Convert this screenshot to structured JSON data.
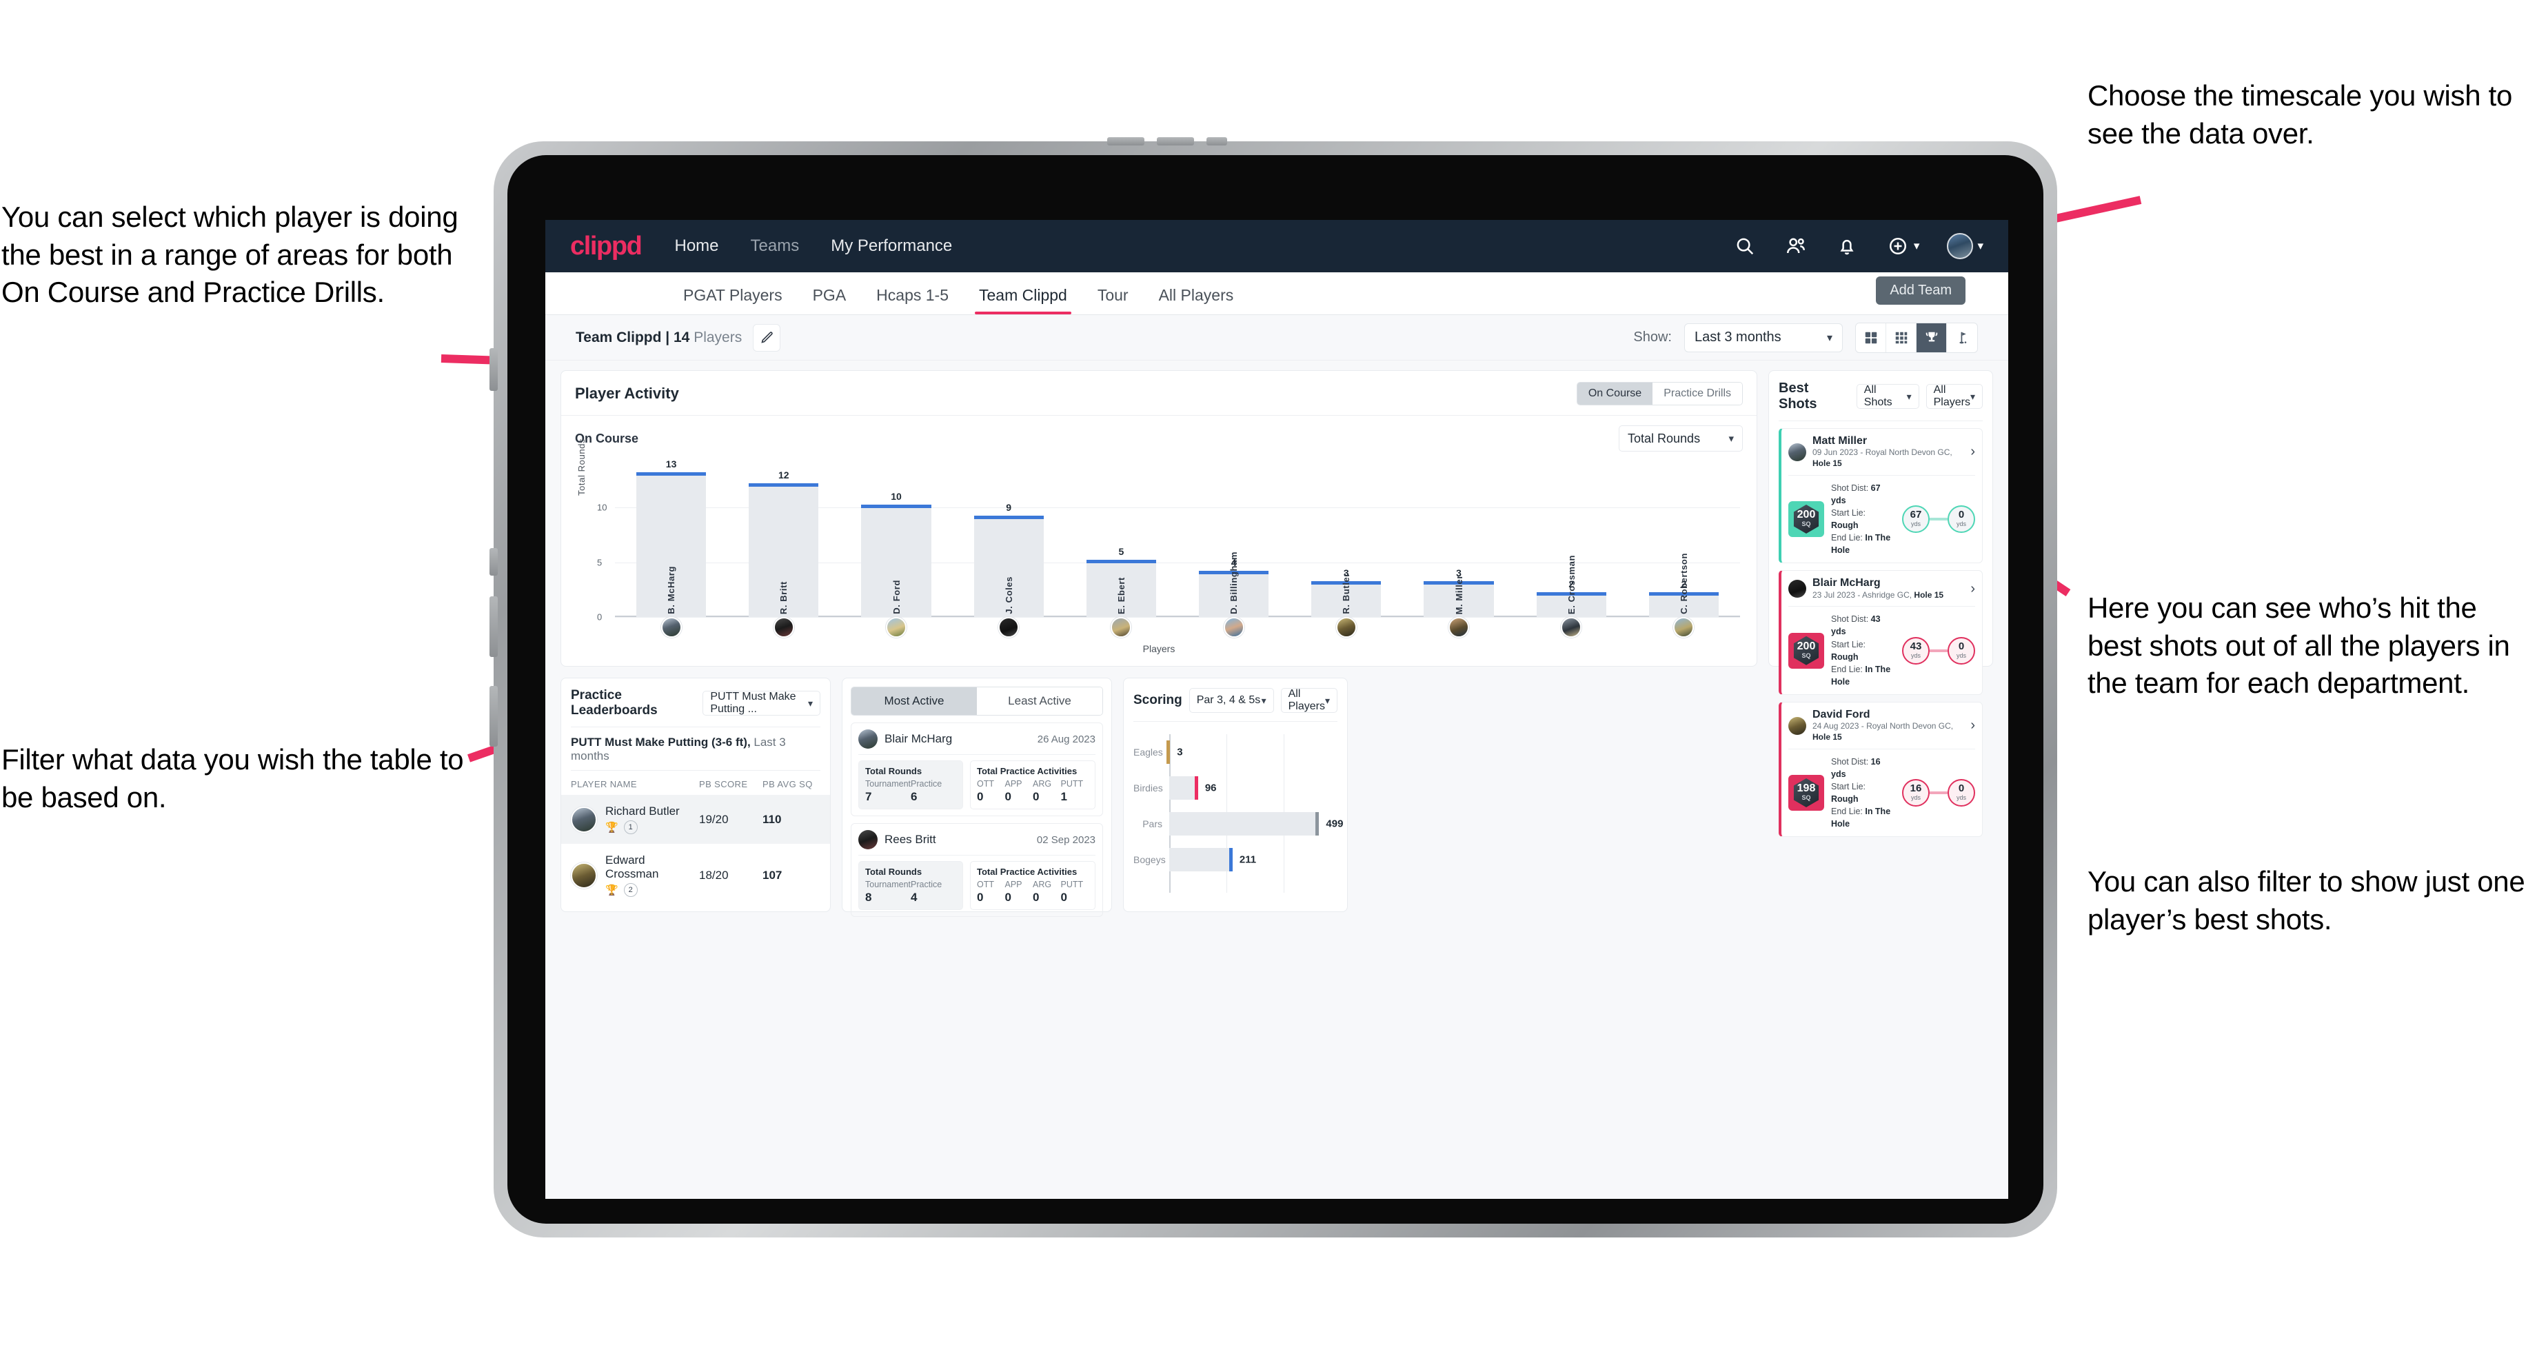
{
  "annotations": {
    "left_top": "You can select which player is doing the best in a range of areas for both On Course and Practice Drills.",
    "left_bottom": "Filter what data you wish the table to be based on.",
    "right_top": "Choose the timescale you wish to see the data over.",
    "right_mid": "Here you can see who’s hit the best shots out of all the players in the team for each department.",
    "right_bottom": "You can also filter to show just one player’s best shots."
  },
  "topnav": {
    "logo": "clippd",
    "links": [
      {
        "label": "Home"
      },
      {
        "label": "Teams"
      },
      {
        "label": "My Performance"
      }
    ],
    "icons": [
      "search-icon",
      "people-icon",
      "bell-icon",
      "plus-circle-icon",
      "avatar"
    ]
  },
  "tabs": [
    {
      "label": "PGAT Players",
      "active": false
    },
    {
      "label": "PGA",
      "active": false
    },
    {
      "label": "Hcaps 1-5",
      "active": false
    },
    {
      "label": "Team Clippd",
      "active": true
    },
    {
      "label": "Tour",
      "active": false
    },
    {
      "label": "All Players",
      "active": false
    }
  ],
  "tooltip": {
    "add_team": "Add Team"
  },
  "subheader": {
    "team_name": "Team Clippd",
    "separator": " | ",
    "player_count": "14",
    "players_word": " Players",
    "show_label": "Show:",
    "timescale_value": "Last 3 months",
    "view_icons": [
      "grid-2x2-icon",
      "grid-3x3-icon",
      "trophy-icon",
      "flag-icon"
    ],
    "active_view": "trophy-icon"
  },
  "player_activity": {
    "title": "Player Activity",
    "segments": [
      {
        "label": "On Course",
        "active": true
      },
      {
        "label": "Practice Drills",
        "active": false
      }
    ],
    "sub_label": "On Course",
    "metric_select": "Total Rounds"
  },
  "chart_data": {
    "type": "bar",
    "title": "Player Activity - On Course",
    "xlabel": "Players",
    "ylabel": "Total Rounds",
    "ylim": [
      0,
      14
    ],
    "yticks": [
      0,
      5,
      10
    ],
    "grid": true,
    "categories": [
      "B. McHarg",
      "R. Britt",
      "D. Ford",
      "J. Coles",
      "E. Ebert",
      "D. Billingham",
      "R. Butler",
      "M. Miller",
      "E. Crossman",
      "C. Robertson"
    ],
    "values": [
      13,
      12,
      10,
      9,
      5,
      4,
      3,
      3,
      2,
      2
    ],
    "bar_color": "#e7eaee",
    "cap_color": "#3b78d8"
  },
  "best_shots": {
    "title": "Best Shots",
    "shot_filter": "All Shots",
    "player_filter": "All Players",
    "cards": [
      {
        "name": "Matt Miller",
        "meta_prefix": "09 Jun 2023 - Royal North Devon GC, ",
        "meta_hole": "Hole 15",
        "badge_value": "200",
        "badge_unit": "SQ",
        "accent": "#3ecfb2",
        "shot_dist_label": "Shot Dist: ",
        "shot_dist": "67 yds",
        "start_lie_label": "Start Lie: ",
        "start_lie": "Rough",
        "end_lie_label": "End Lie: ",
        "end_lie": "In The Hole",
        "from_value": "67",
        "from_unit": "yds",
        "to_value": "0",
        "to_unit": "yds"
      },
      {
        "name": "Blair McHarg",
        "meta_prefix": "23 Jul 2023 - Ashridge GC, ",
        "meta_hole": "Hole 15",
        "badge_value": "200",
        "badge_unit": "SQ",
        "accent": "#e0305e",
        "shot_dist_label": "Shot Dist: ",
        "shot_dist": "43 yds",
        "start_lie_label": "Start Lie: ",
        "start_lie": "Rough",
        "end_lie_label": "End Lie: ",
        "end_lie": "In The Hole",
        "from_value": "43",
        "from_unit": "yds",
        "to_value": "0",
        "to_unit": "yds"
      },
      {
        "name": "David Ford",
        "meta_prefix": "24 Aug 2023 - Royal North Devon GC, ",
        "meta_hole": "Hole 15",
        "badge_value": "198",
        "badge_unit": "SQ",
        "accent": "#e0305e",
        "shot_dist_label": "Shot Dist: ",
        "shot_dist": "16 yds",
        "start_lie_label": "Start Lie: ",
        "start_lie": "Rough",
        "end_lie_label": "End Lie: ",
        "end_lie": "In The Hole",
        "from_value": "16",
        "from_unit": "yds",
        "to_value": "0",
        "to_unit": "yds"
      }
    ]
  },
  "practice_leaderboards": {
    "title": "Practice Leaderboards",
    "drill_select": "PUTT Must Make Putting ...",
    "subtitle_bold": "PUTT Must Make Putting (3-6 ft),",
    "subtitle_rest": " Last 3 months",
    "columns": [
      "PLAYER NAME",
      "PB SCORE",
      "PB AVG SQ"
    ],
    "rows": [
      {
        "name": "Richard Butler",
        "rank": "1",
        "trophy": "gold",
        "pb_score": "19/20",
        "pb_avg_sq": "110",
        "highlight": true
      },
      {
        "name": "Edward Crossman",
        "rank": "2",
        "trophy": "silver",
        "pb_score": "18/20",
        "pb_avg_sq": "107",
        "highlight": false
      }
    ]
  },
  "activity": {
    "tabs": [
      {
        "label": "Most Active",
        "active": true
      },
      {
        "label": "Least Active",
        "active": false
      }
    ],
    "cards": [
      {
        "name": "Blair McHarg",
        "date": "26 Aug 2023",
        "rounds_title": "Total Rounds",
        "rounds": [
          {
            "key": "Tournament",
            "value": "7"
          },
          {
            "key": "Practice",
            "value": "6"
          }
        ],
        "practice_title": "Total Practice Activities",
        "practice": [
          {
            "key": "OTT",
            "value": "0"
          },
          {
            "key": "APP",
            "value": "0"
          },
          {
            "key": "ARG",
            "value": "0"
          },
          {
            "key": "PUTT",
            "value": "1"
          }
        ]
      },
      {
        "name": "Rees Britt",
        "date": "02 Sep 2023",
        "rounds_title": "Total Rounds",
        "rounds": [
          {
            "key": "Tournament",
            "value": "8"
          },
          {
            "key": "Practice",
            "value": "4"
          }
        ],
        "practice_title": "Total Practice Activities",
        "practice": [
          {
            "key": "OTT",
            "value": "0"
          },
          {
            "key": "APP",
            "value": "0"
          },
          {
            "key": "ARG",
            "value": "0"
          },
          {
            "key": "PUTT",
            "value": "0"
          }
        ]
      }
    ]
  },
  "scoring": {
    "title": "Scoring",
    "par_filter": "Par 3, 4 & 5s",
    "player_filter": "All Players",
    "chart": {
      "type": "bar",
      "orientation": "horizontal",
      "categories": [
        "Eagles",
        "Birdies",
        "Pars",
        "Bogeys"
      ],
      "values": [
        3,
        96,
        499,
        211
      ],
      "colors": [
        "#c59a4e",
        "#ec2d62",
        "#8c959d",
        "#3b78d8"
      ],
      "xmax": 560,
      "grid": true
    }
  }
}
